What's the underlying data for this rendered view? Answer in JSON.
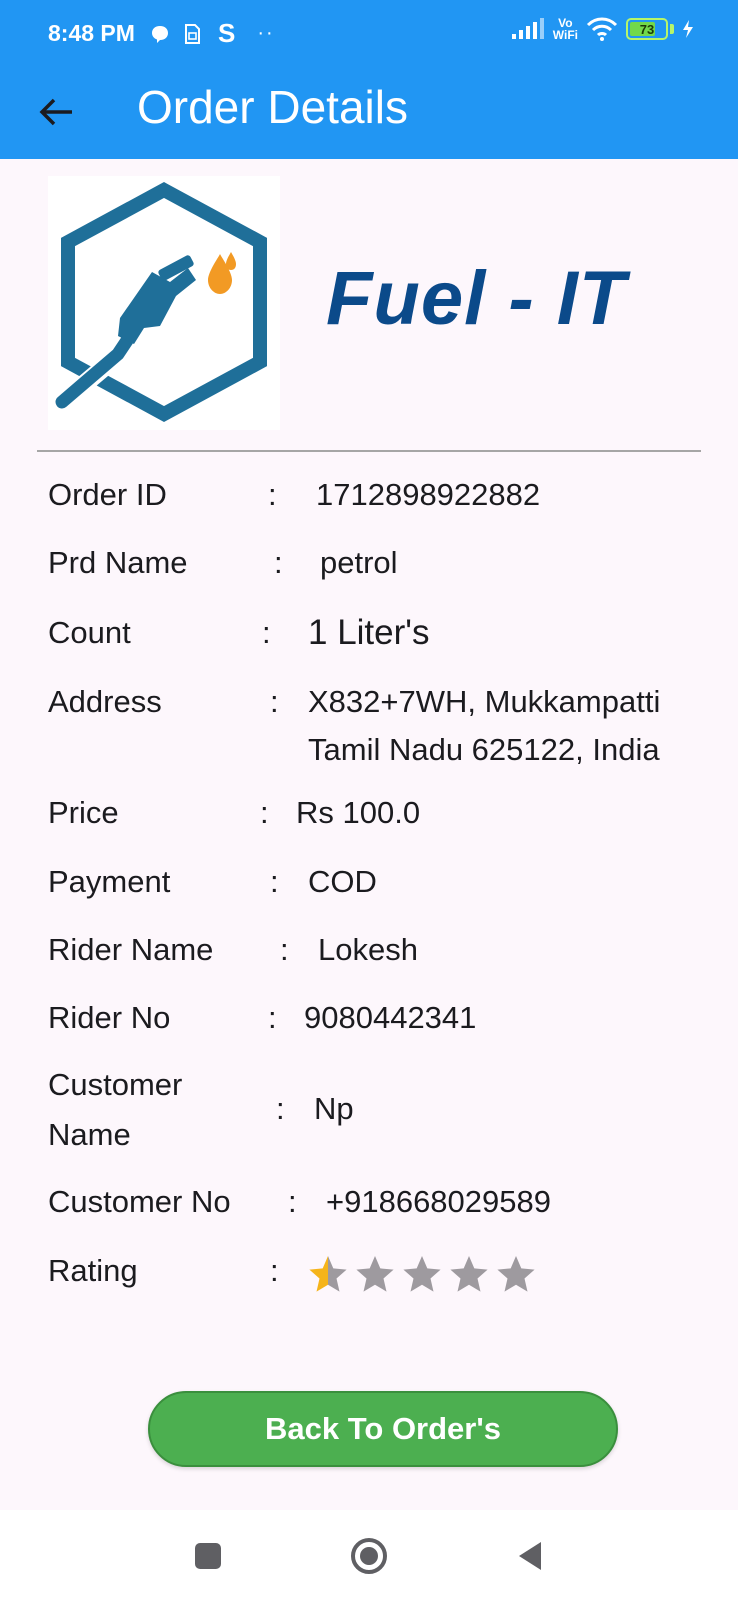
{
  "status_bar": {
    "time": "8:48 PM",
    "s_label": "S",
    "dots": "··",
    "network_label_top": "Vo",
    "network_label_bottom": "WiFi",
    "battery_level": "73",
    "battery_fraction": 0.73,
    "icons": [
      "chat-bubble-icon",
      "sim-icon",
      "signal-icon",
      "wifi-icon",
      "battery-icon",
      "charging-icon"
    ]
  },
  "app_bar": {
    "title": "Order Details",
    "back_icon": "arrow-left-icon",
    "color": "#2196f3"
  },
  "brand": {
    "name": "Fuel - IT",
    "logo_icon": "fuel-nozzle-hexagon-logo",
    "color": "#0b4a8a"
  },
  "details": {
    "rows": [
      {
        "label": "Order ID",
        "value": "1712898922882"
      },
      {
        "label": "Prd Name",
        "value": "petrol"
      },
      {
        "label": "Count",
        "value": "1  Liter's"
      },
      {
        "label": "Address",
        "value_line1": "X832+7WH, Mukkampatti",
        "value_line2": "Tamil Nadu 625122, India"
      },
      {
        "label": "Price",
        "value": "Rs 100.0"
      },
      {
        "label": "Payment",
        "value": "COD"
      },
      {
        "label": "Rider Name",
        "value": "Lokesh"
      },
      {
        "label": "Rider No",
        "value": "9080442341"
      },
      {
        "label_line1": "Customer",
        "label_line2": "Name",
        "value": "Np"
      },
      {
        "label": "Customer No",
        "value": "+918668029589"
      },
      {
        "label": "Rating",
        "rating": 0.5,
        "max": 5
      }
    ],
    "separator": ":"
  },
  "actions": {
    "back_label": "Back To Order's",
    "color": "#4caf50"
  },
  "nav": {
    "icons": [
      "recents-square-icon",
      "home-circle-icon",
      "back-triangle-icon"
    ]
  }
}
